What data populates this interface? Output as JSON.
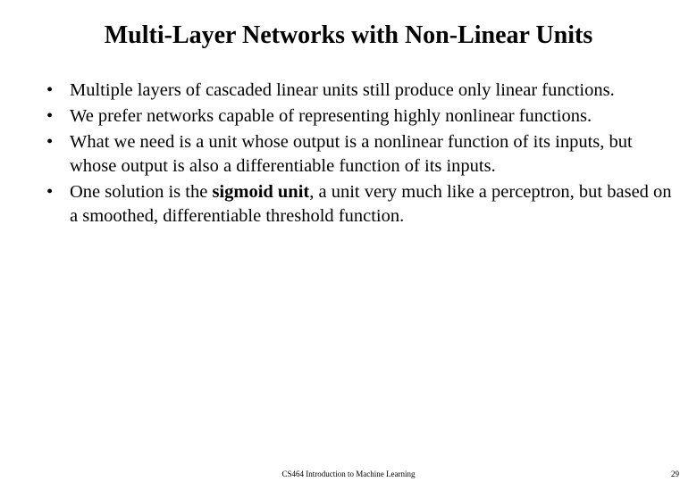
{
  "title": "Multi-Layer Networks with Non-Linear Units",
  "bullets": [
    {
      "text": "Multiple layers of cascaded linear units still produce only linear functions."
    },
    {
      "text": "We prefer networks capable of representing highly nonlinear functions."
    },
    {
      "text": "What we need is a unit whose output is a nonlinear function of its inputs, but whose output is also a differentiable function of its inputs."
    },
    {
      "pre": "One solution is the ",
      "bold": "sigmoid unit",
      "post": ", a unit very much like a perceptron, but based on a smoothed, differentiable threshold function."
    }
  ],
  "footer": {
    "course": "CS464 Introduction to Machine Learning",
    "page": "29"
  }
}
